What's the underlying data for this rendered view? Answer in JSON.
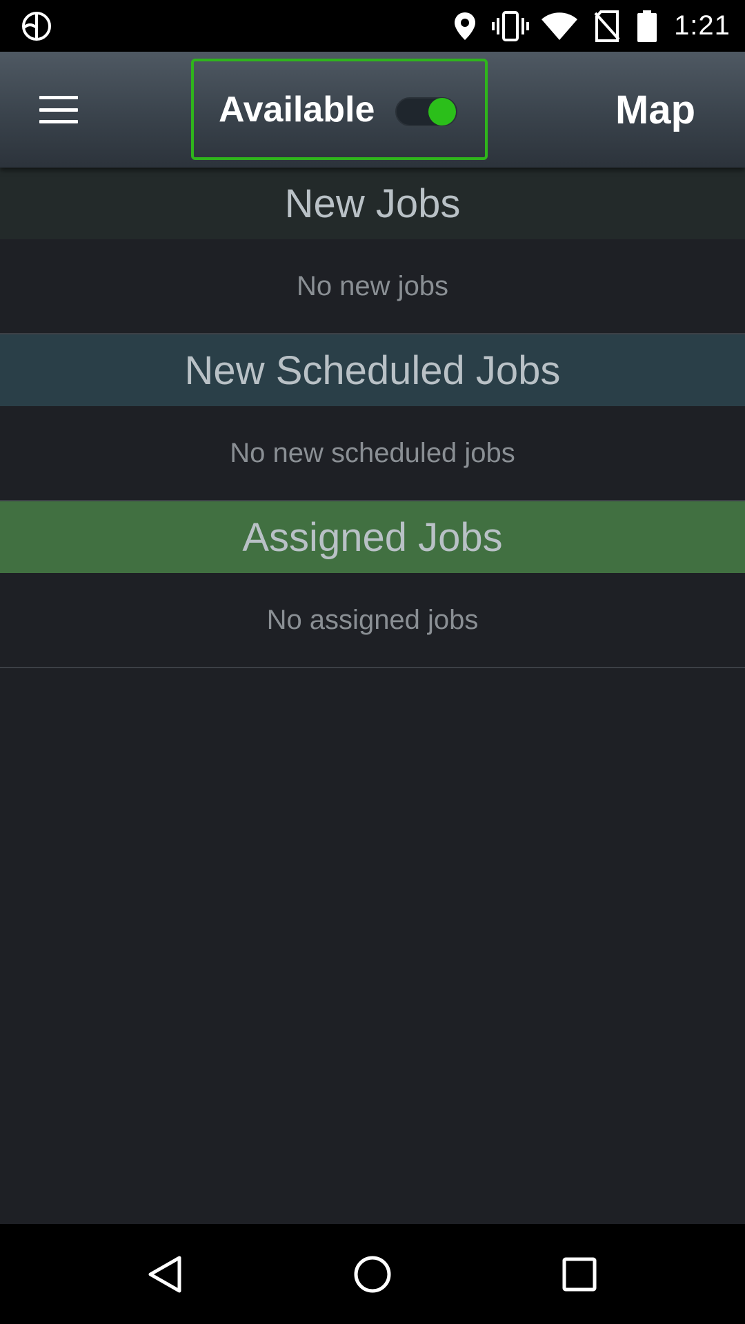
{
  "status_bar": {
    "time": "1:21",
    "icons": [
      "app-logo-icon",
      "location-icon",
      "vibrate-icon",
      "wifi-icon",
      "no-sim-icon",
      "battery-icon"
    ]
  },
  "app_bar": {
    "availability_label": "Available",
    "availability_on": true,
    "map_label": "Map",
    "accent_color": "#2fb51c"
  },
  "sections": [
    {
      "title": "New Jobs",
      "empty_text": "No new jobs",
      "header_color": "#232a2a"
    },
    {
      "title": "New Scheduled Jobs",
      "empty_text": "No new scheduled jobs",
      "header_color": "#2a3f48"
    },
    {
      "title": "Assigned Jobs",
      "empty_text": "No assigned jobs",
      "header_color": "#417041"
    }
  ],
  "nav_bar": {
    "buttons": [
      "back-icon",
      "home-icon",
      "recents-icon"
    ]
  }
}
